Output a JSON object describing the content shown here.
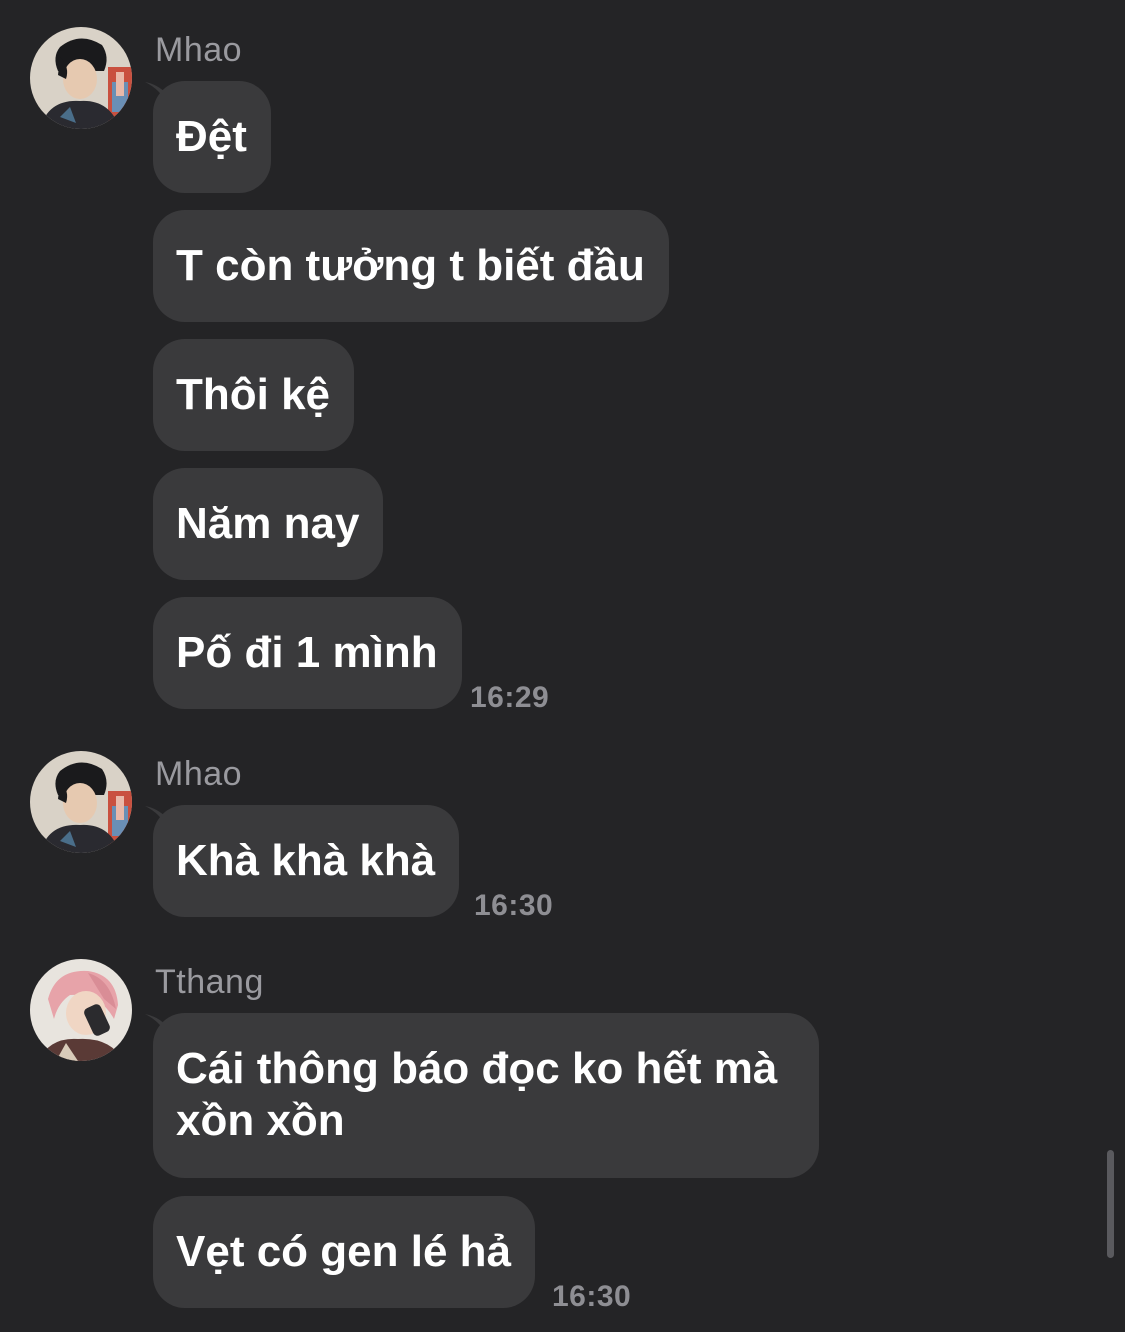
{
  "colors": {
    "background": "#242426",
    "bubble": "#3a3a3c",
    "text": "#ffffff",
    "sender": "#9a9a9f",
    "timestamp": "#8e8e93"
  },
  "groups": [
    {
      "sender": "Mhao",
      "avatar": "avatar-mhao",
      "messages": [
        "Đệt",
        "T còn tưởng t biết đầu",
        "Thôi kệ",
        "Năm nay",
        "Pố đi 1 mình"
      ],
      "time": "16:29"
    },
    {
      "sender": "Mhao",
      "avatar": "avatar-mhao",
      "messages": [
        "Khà khà khà"
      ],
      "time": "16:30"
    },
    {
      "sender": "Tthang",
      "avatar": "avatar-tthang",
      "messages": [
        "Cái thông báo đọc ko hết mà xồn xồn",
        "Vẹt có gen lé hả"
      ],
      "time": "16:30"
    }
  ]
}
